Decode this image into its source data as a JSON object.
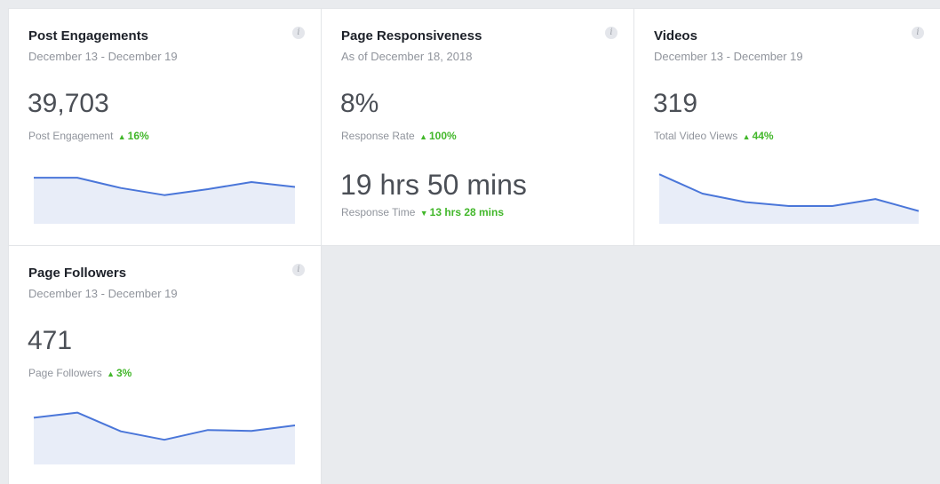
{
  "colors": {
    "accent": "#4a76d9",
    "fill": "#e8edf8",
    "positive": "#42b72a",
    "muted": "#90949c"
  },
  "cards": {
    "post_engagements": {
      "title": "Post Engagements",
      "subtitle": "December 13 - December 19",
      "value": "39,703",
      "metric_label": "Post Engagement",
      "change_icon": "up-triangle",
      "change_arrow": "▲",
      "change": "16%"
    },
    "page_responsiveness": {
      "title": "Page Responsiveness",
      "subtitle": "As of December 18, 2018",
      "response_rate": "8%",
      "response_rate_label": "Response Rate",
      "rate_change_icon": "up-triangle",
      "rate_change_arrow": "▲",
      "rate_change": "100%",
      "response_time": "19 hrs 50 mins",
      "response_time_label": "Response Time",
      "time_change_icon": "down-triangle",
      "time_change_arrow": "▼",
      "time_change": "13 hrs 28 mins"
    },
    "videos": {
      "title": "Videos",
      "subtitle": "December 13 - December 19",
      "value": "319",
      "metric_label": "Total Video Views",
      "change_icon": "up-triangle",
      "change_arrow": "▲",
      "change": "44%"
    },
    "page_followers": {
      "title": "Page Followers",
      "subtitle": "December 13 - December 19",
      "value": "471",
      "metric_label": "Page Followers",
      "change_icon": "up-triangle",
      "change_arrow": "▲",
      "change": "3%"
    }
  },
  "info_icon": "info-icon",
  "info_glyph": "i",
  "chart_data": [
    {
      "type": "area",
      "series": [
        {
          "values": [
            8.5,
            8.5,
            6.6,
            5.3,
            6.4,
            7.7,
            6.8
          ]
        }
      ],
      "ylim": [
        0,
        10
      ]
    },
    {
      "type": "area",
      "series": [
        {
          "values": [
            12.8,
            7.8,
            5.6,
            4.6,
            4.6,
            6.4,
            3.3
          ]
        }
      ],
      "ylim": [
        0,
        14
      ]
    },
    {
      "type": "area",
      "series": [
        {
          "values": [
            11.0,
            12.2,
            7.8,
            5.8,
            8.1,
            7.9,
            9.2
          ]
        }
      ],
      "ylim": [
        0,
        14
      ]
    }
  ]
}
